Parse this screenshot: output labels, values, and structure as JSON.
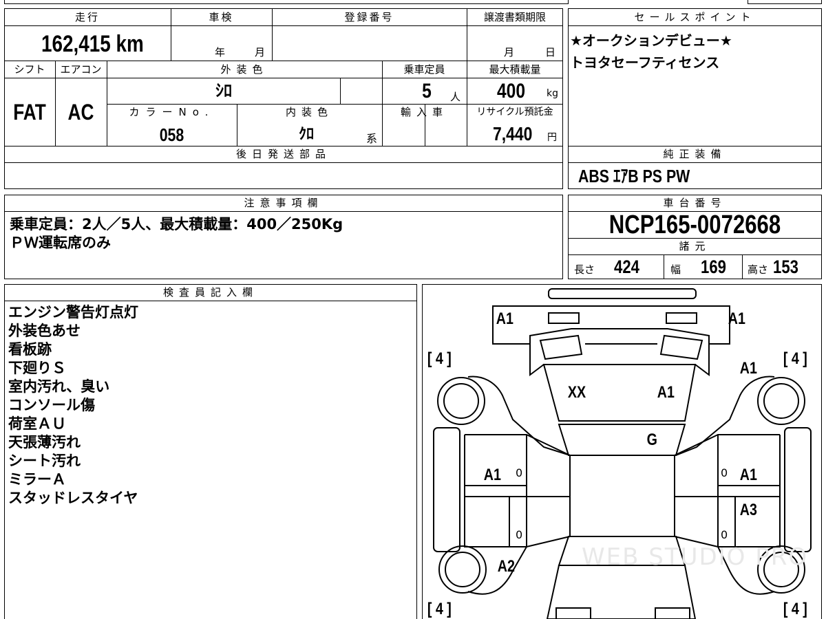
{
  "mileage": {
    "label": "走行",
    "value": "162,415",
    "unit": "km"
  },
  "inspection": {
    "label": "車検",
    "year_unit": "年",
    "month_unit": "月"
  },
  "registration": {
    "label": "登録番号"
  },
  "transfer": {
    "label": "譲渡書類期限",
    "month_unit": "月",
    "day_unit": "日"
  },
  "shift": {
    "label": "シフト",
    "value": "FAT"
  },
  "aircon": {
    "label": "エアコン",
    "value": "AC"
  },
  "exterior_color": {
    "label": "外装色",
    "value": "ｼﾛ"
  },
  "capacity": {
    "label": "乗車定員",
    "value": "5",
    "unit": "人"
  },
  "max_load": {
    "label": "最大積載量",
    "value": "400",
    "unit": "kg"
  },
  "color_no": {
    "label": "カラーNo.",
    "value": "058"
  },
  "interior_color": {
    "label": "内装色",
    "value": "ｸﾛ",
    "unit": "系"
  },
  "import": {
    "label": "輸入車"
  },
  "recycle": {
    "label": "リサイクル預託金",
    "value": "7,440",
    "unit": "円"
  },
  "later_parts": {
    "label": "後日発送部品"
  },
  "sales_points": {
    "label": "セールスポイント",
    "lines": [
      "★オークションデビュー★",
      "トヨタセーフティセンス"
    ]
  },
  "genuine_equipment": {
    "label": "純正装備",
    "value": "ABS ｴｱB PS PW"
  },
  "notes": {
    "label": "注意事項欄",
    "lines": [
      "乗車定員：2人／5人、最大積載量：400／250Kg",
      "ＰＷ運転席のみ"
    ]
  },
  "chassis": {
    "label": "車台番号",
    "value": "NCP165-0072668"
  },
  "specs": {
    "label": "諸元",
    "length_label": "長さ",
    "length": "424",
    "width_label": "幅",
    "width": "169",
    "height_label": "高さ",
    "height": "153"
  },
  "inspector": {
    "label": "検査員記入欄",
    "lines": [
      "エンジン警告灯点灯",
      "外装色あせ",
      "看板跡",
      "下廻りＳ",
      "室内汚れ、臭い",
      "コンソール傷",
      "荷室ＡＵ",
      "天張薄汚れ",
      "シート汚れ",
      "ミラーＡ",
      "スタッドレスタイヤ"
    ]
  },
  "diagram": {
    "marks": {
      "front_left": "A1",
      "front_right": "A1",
      "fender_right": "A1",
      "hood_left": "XX",
      "hood_right": "A1",
      "windshield": "G",
      "front_door_left": "A1",
      "front_door_right": "A1",
      "rear_door_right": "A3",
      "rear_left": "A2"
    },
    "tires": [
      "[ 4 ]",
      "[ 4 ]",
      "[ 4 ]",
      "[ 4 ]"
    ],
    "door_zeros": [
      "0",
      "0",
      "0",
      "0"
    ]
  },
  "watermark": "WEB STUDIO PRO"
}
